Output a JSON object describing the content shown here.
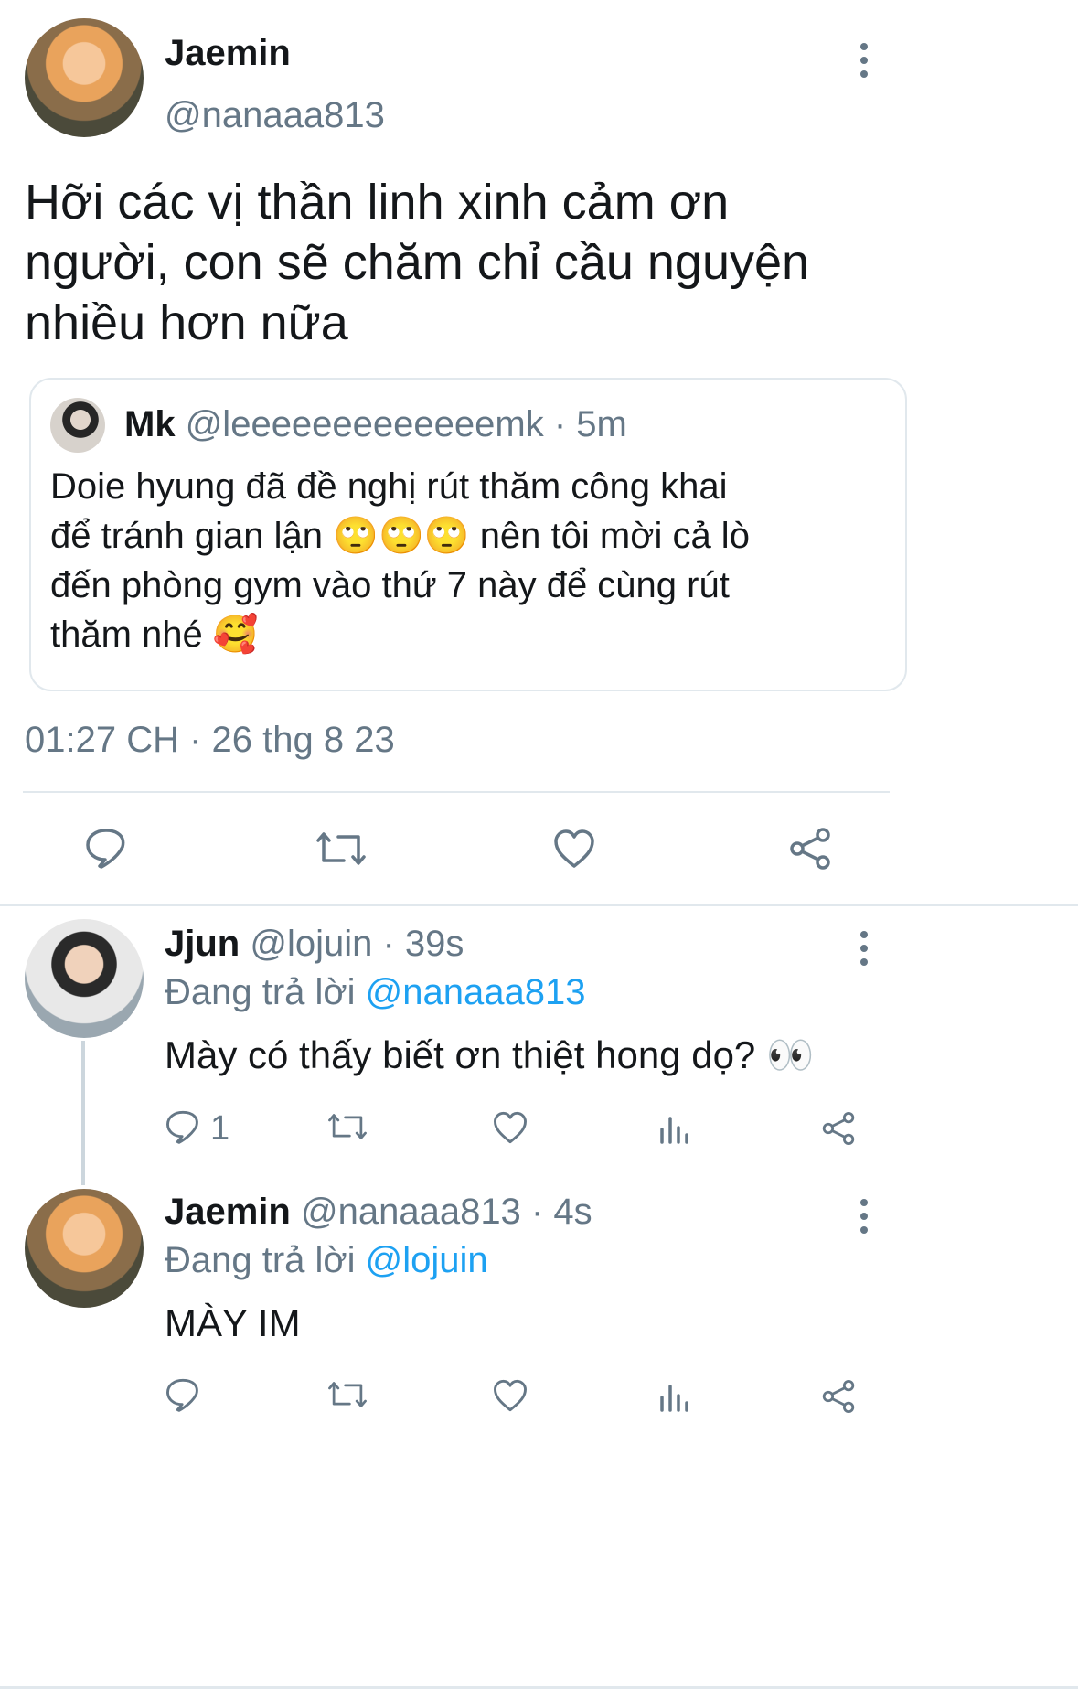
{
  "main_tweet": {
    "name": "Jaemin",
    "handle": "@nanaaa813",
    "text_line1": "Hỡi các vị thần linh xinh cảm ơn",
    "text_line2": "người, con sẽ chăm chỉ cầu nguyện",
    "text_line3": "nhiều hơn nữa",
    "timestamp": "01:27 CH · 26 thg 8 23"
  },
  "quoted_tweet": {
    "name": "Mk",
    "handle": "@leeeeeeeeeeeeemk",
    "time": "· 5m",
    "line1": "Doie hyung đã đề nghị rút thăm công khai",
    "line2a": "để tránh gian lận",
    "emoji_roll": "🙄🙄🙄",
    "line2b": "nên tôi mời cả lò",
    "line3": "đến phòng gym vào thứ 7 này để cùng rút",
    "line4": "thăm nhé",
    "emoji_love": "🥰"
  },
  "reply1": {
    "name": "Jjun",
    "handle": "@lojuin",
    "time": "· 39s",
    "replying_prefix": "Đang trả lời",
    "replying_to": "@nanaaa813",
    "text": "Mày có thấy biết ơn thiệt hong dọ?",
    "emoji_eyes": "👀",
    "reply_count": "1"
  },
  "reply2": {
    "name": "Jaemin",
    "handle": "@nanaaa813",
    "time": "· 4s",
    "replying_prefix": "Đang trả lời",
    "replying_to": "@lojuin",
    "text": "MÀY IM"
  },
  "icons": [
    "more-dots-icon",
    "reply-icon",
    "retweet-icon",
    "like-icon",
    "share-icon",
    "analytics-icon"
  ],
  "colors": {
    "text": "#14171a",
    "secondary": "#657786",
    "link": "#1da1f2",
    "divider": "#e1e8ed"
  }
}
